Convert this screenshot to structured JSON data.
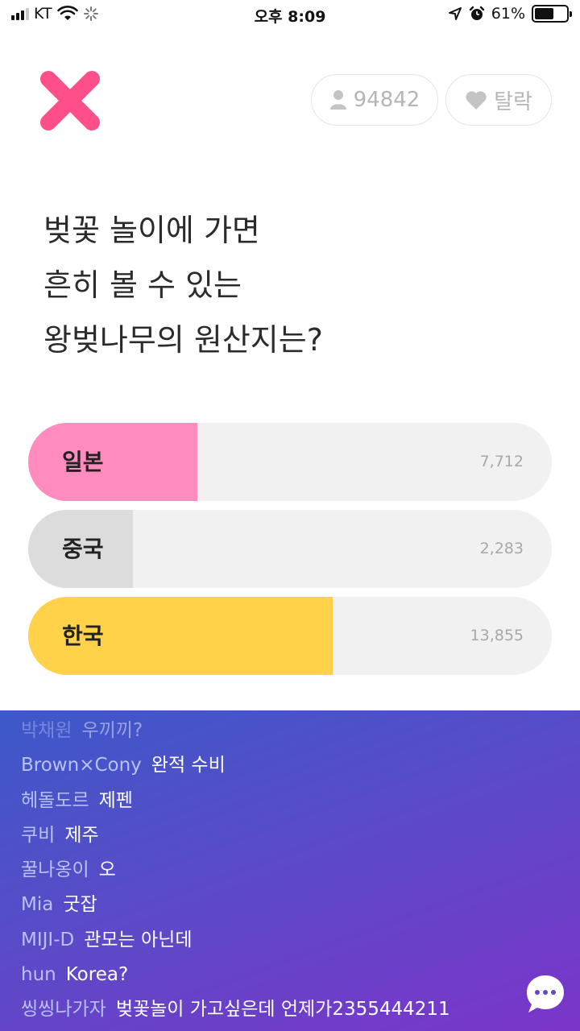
{
  "status_bar": {
    "carrier": "KT",
    "time": "오후 8:09",
    "battery_percent": "61%",
    "battery_level": 0.61
  },
  "header": {
    "close_icon": "x-mark-icon",
    "participants": "94842",
    "leave_label": "탈락",
    "colors": {
      "x_mark": "#ff4f8a",
      "pill_text": "#b5b5b5"
    }
  },
  "question": {
    "lines": [
      "벚꽃 놀이에 가면",
      "흔히 볼 수 있는",
      "왕벚나무의 원산지는?"
    ]
  },
  "options": [
    {
      "label": "일본",
      "count": "7,712",
      "fraction": 0.323,
      "color": "#ff8bbf"
    },
    {
      "label": "중국",
      "count": "2,283",
      "fraction": 0.2,
      "color": "#dcdcdc"
    },
    {
      "label": "한국",
      "count": "13,855",
      "fraction": 0.581,
      "color": "#ffd24a"
    }
  ],
  "chat": {
    "messages": [
      {
        "user": "박채원",
        "text": "우끼끼?"
      },
      {
        "user": "Brown×Cony",
        "text": "완적 수비"
      },
      {
        "user": "헤돌도르",
        "text": "제펜"
      },
      {
        "user": "쿠비",
        "text": "제주"
      },
      {
        "user": "꿀나옹이",
        "text": "오"
      },
      {
        "user": "Mia",
        "text": "굿잡"
      },
      {
        "user": "MIJI-D",
        "text": "관모는 아닌데"
      },
      {
        "user": "hun",
        "text": "Korea?"
      },
      {
        "user": "씽씽나가자",
        "text": "벚꽃놀이 가고싶은데 언제가2355444211"
      }
    ]
  }
}
